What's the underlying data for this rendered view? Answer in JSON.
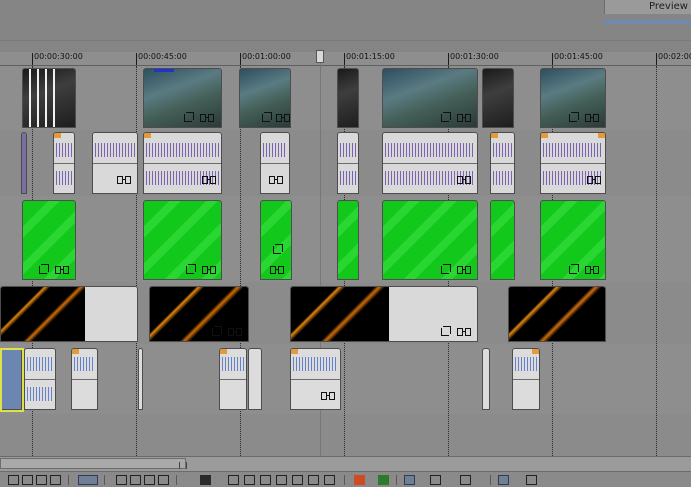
{
  "window": {
    "preview_tab": "Preview"
  },
  "timeline": {
    "ruler_ticks": [
      "00:00:30:00",
      "00:00:45:00",
      "00:01:00:00",
      "00:01:15:00",
      "00:01:30:00",
      "00:01:45:00",
      "00:02:00"
    ]
  },
  "icons": [
    "crop-icon",
    "event-envelope-icon",
    "cursor-tool-icon",
    "edit-tool-icon",
    "trim-icon",
    "split-icon",
    "marker-icon",
    "region-icon",
    "snap-icon",
    "lock-icon"
  ],
  "colors": {
    "green_screen": "#12c81a",
    "audio_wave": "#6a4ea6",
    "audio_wave_blue": "#4f73c8",
    "clip_cap": "#2233cc",
    "fade_handle": "#e29a3a",
    "orange_game": "#e5870f",
    "selection": "#dfe04a",
    "preview_accent": "#5a8ed6"
  }
}
